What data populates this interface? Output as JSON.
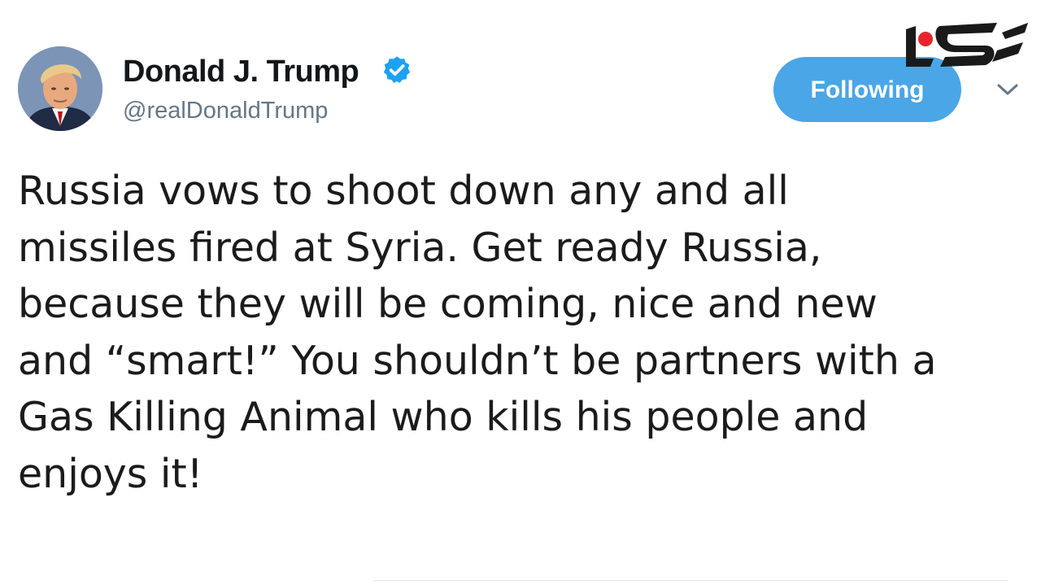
{
  "user": {
    "display_name": "Donald J. Trump",
    "handle": "@realDonaldTrump",
    "verified": true
  },
  "follow_button": {
    "label": "Following"
  },
  "tweet": {
    "lines": [
      "Russia vows to shoot down any and all",
      "missiles fired at Syria. Get ready Russia,",
      "because they will be coming, nice and new",
      "and “smart!” You shouldn’t be partners with a",
      "Gas Killing Animal who kills his people and",
      "enjoys it!"
    ]
  },
  "icons": {
    "verified": "verified-badge-icon",
    "more": "chevron-down-icon",
    "watermark": "site-logo"
  },
  "colors": {
    "accent": "#1da1f2",
    "button": "#4aa6e6",
    "handle": "#657786",
    "logo_red": "#e3262d",
    "logo_black": "#1a1a1a"
  }
}
